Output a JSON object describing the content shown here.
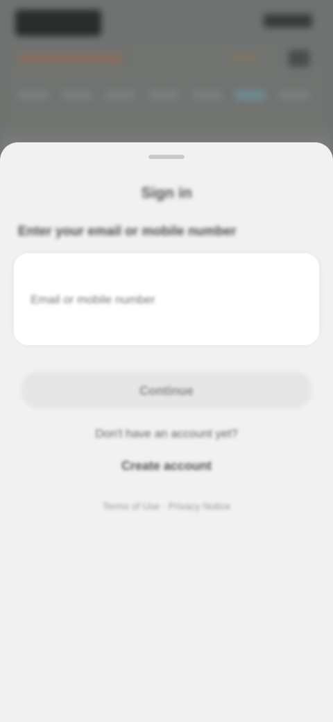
{
  "background": {
    "colors": {
      "overlay": "#6e716f",
      "sheet": "#f1f1f1"
    }
  },
  "sheet": {
    "title": "Sign in",
    "heading": "Enter your email or mobile number",
    "input": {
      "placeholder": "Email or mobile number",
      "value": ""
    },
    "continue_label": "Continue",
    "prompt": "Don't have an account yet?",
    "create_account_label": "Create account",
    "legal": "Terms of Use · Privacy Notice"
  }
}
